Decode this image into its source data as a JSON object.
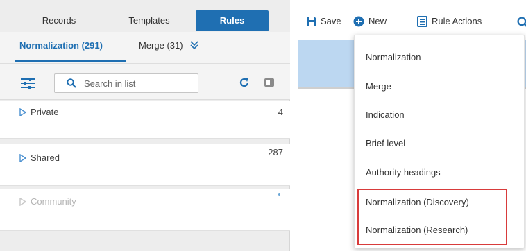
{
  "top_nav": {
    "tabs": [
      {
        "label": "Records",
        "active": false
      },
      {
        "label": "Templates",
        "active": false
      },
      {
        "label": "Rules",
        "active": true
      }
    ]
  },
  "sub_tabs": {
    "items": [
      {
        "label": "Normalization (291)",
        "active": true
      },
      {
        "label": "Merge (31)",
        "active": false
      }
    ],
    "more_icon": "double-chevron-down-icon"
  },
  "list_toolbar": {
    "filter_icon": "sliders-icon",
    "search": {
      "placeholder": "Search in list",
      "value": ""
    },
    "refresh_icon": "refresh-icon",
    "panel_icon": "panel-toggle-icon"
  },
  "groups": [
    {
      "label": "Private",
      "count": "4"
    },
    {
      "label": "Shared",
      "count": "287"
    },
    {
      "label": "Community",
      "count": ""
    }
  ],
  "action_toolbar": {
    "save_label": "Save",
    "new_label": "New",
    "rule_actions_label": "Rule Actions"
  },
  "new_menu": {
    "items": [
      "Normalization",
      "Merge",
      "Indication",
      "Brief level",
      "Authority headings",
      "Normalization (Discovery)",
      "Normalization (Research)"
    ],
    "highlighted_items": [
      "Normalization (Discovery)",
      "Normalization (Research)"
    ]
  },
  "colors": {
    "accent": "#1f6fb2",
    "highlight": "#d83b3b",
    "band": "#bcd7f1"
  }
}
